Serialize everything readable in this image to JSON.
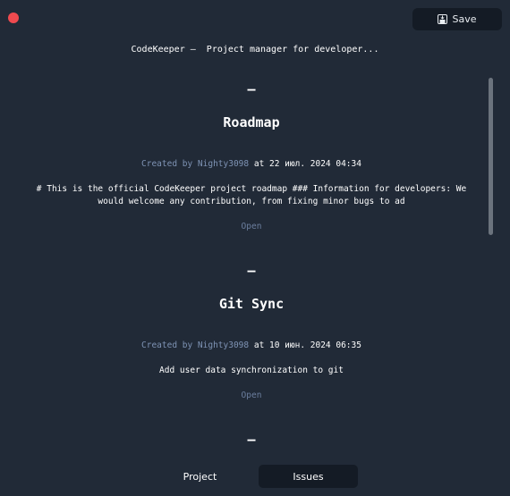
{
  "window": {
    "title": "CodeKeeper —  Project manager for developer..."
  },
  "toolbar": {
    "save_label": "Save",
    "save_icon": "save-icon"
  },
  "issues": [
    {
      "separator": "—",
      "title": "Roadmap",
      "created_prefix": "Created by Nighty3098",
      "created_suffix": " at 22 июл. 2024 04:34",
      "description": "# This is the official CodeKeeper project roadmap ### Information for developers: We would welcome any contribution, from fixing minor bugs to ad",
      "open_label": "Open"
    },
    {
      "separator": "—",
      "title": "Git Sync",
      "created_prefix": "Created by Nighty3098",
      "created_suffix": " at 10 июн. 2024 06:35",
      "description": "Add user data synchronization to git",
      "open_label": "Open"
    },
    {
      "separator": "—"
    }
  ],
  "tabs": [
    {
      "label": "Project",
      "active": false
    },
    {
      "label": "Issues",
      "active": true
    }
  ],
  "colors": {
    "background": "#212a37",
    "button_bg": "#141b25",
    "close": "#ef4a4f",
    "meta_link": "#7e93b4"
  }
}
